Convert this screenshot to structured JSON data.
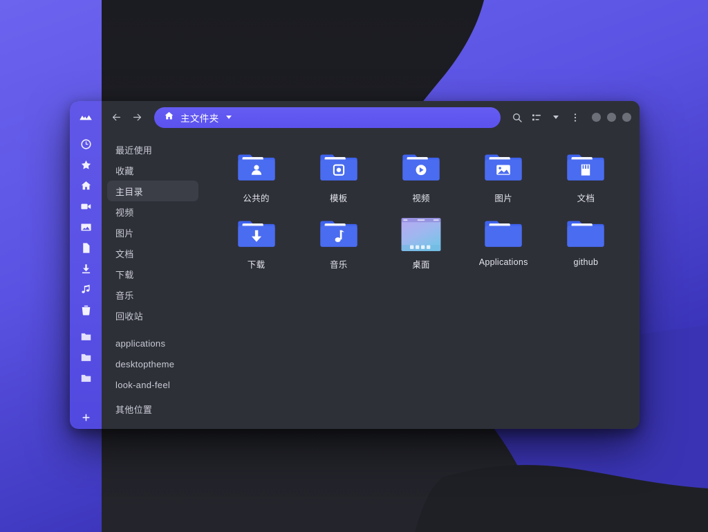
{
  "wallpaper": {
    "purple": "#5b55e0",
    "purple_dark": "#3a35b0",
    "dark": "#1e1f25",
    "dark2": "#222329"
  },
  "window": {
    "accent": "#5f56ea",
    "surface": "#2e3038",
    "selected_bg": "#3b3d47",
    "folder_blue": "#4a6cf0"
  },
  "rail": {
    "logo": "mountains-icon",
    "icons": [
      {
        "name": "clock-icon"
      },
      {
        "name": "star-icon"
      },
      {
        "name": "home-icon"
      },
      {
        "name": "video-camera-icon"
      },
      {
        "name": "image-icon"
      },
      {
        "name": "document-icon"
      },
      {
        "name": "download-icon"
      },
      {
        "name": "music-icon"
      },
      {
        "name": "trash-icon"
      },
      {
        "name": "folder-icon"
      },
      {
        "name": "folder-icon"
      },
      {
        "name": "folder-icon"
      }
    ],
    "add_label": "+"
  },
  "toolbar": {
    "back_icon": "arrow-left-icon",
    "forward_icon": "arrow-right-icon",
    "path_home_icon": "home-icon",
    "path_label": "主文件夹",
    "path_caret_icon": "chevron-down-icon",
    "search_icon": "search-icon",
    "view_list_icon": "view-list-icon",
    "view_caret_icon": "chevron-down-icon",
    "menu_icon": "kebab-menu-icon",
    "window_controls": [
      "minimize-button",
      "maximize-button",
      "close-button"
    ]
  },
  "places": [
    {
      "label": "最近使用",
      "icon": "clock-icon",
      "selected": false
    },
    {
      "label": "收藏",
      "icon": "star-icon",
      "selected": false
    },
    {
      "label": "主目录",
      "icon": "home-icon",
      "selected": true
    },
    {
      "label": "视频",
      "icon": "video-camera-icon",
      "selected": false
    },
    {
      "label": "图片",
      "icon": "image-icon",
      "selected": false
    },
    {
      "label": "文档",
      "icon": "document-icon",
      "selected": false
    },
    {
      "label": "下载",
      "icon": "download-icon",
      "selected": false
    },
    {
      "label": "音乐",
      "icon": "music-icon",
      "selected": false
    },
    {
      "label": "回收站",
      "icon": "trash-icon",
      "selected": false
    }
  ],
  "places_group2": [
    {
      "label": "applications",
      "icon": "folder-icon"
    },
    {
      "label": "desktoptheme",
      "icon": "folder-icon"
    },
    {
      "label": "look-and-feel",
      "icon": "folder-icon"
    }
  ],
  "places_footer": {
    "label": "其他位置",
    "icon": "plus-icon"
  },
  "files": [
    {
      "label": "公共的",
      "icon": "folder-public-icon",
      "emblem": "person"
    },
    {
      "label": "模板",
      "icon": "folder-templates-icon",
      "emblem": "template"
    },
    {
      "label": "视频",
      "icon": "folder-videos-icon",
      "emblem": "play"
    },
    {
      "label": "图片",
      "icon": "folder-pictures-icon",
      "emblem": "picture"
    },
    {
      "label": "文档",
      "icon": "folder-documents-icon",
      "emblem": "document"
    },
    {
      "label": "下载",
      "icon": "folder-downloads-icon",
      "emblem": "download"
    },
    {
      "label": "音乐",
      "icon": "folder-music-icon",
      "emblem": "note"
    },
    {
      "label": "桌面",
      "icon": "desktop-thumbnail",
      "emblem": "thumbnail"
    },
    {
      "label": "Applications",
      "icon": "folder-icon",
      "emblem": "none"
    },
    {
      "label": "github",
      "icon": "folder-icon",
      "emblem": "none"
    }
  ]
}
